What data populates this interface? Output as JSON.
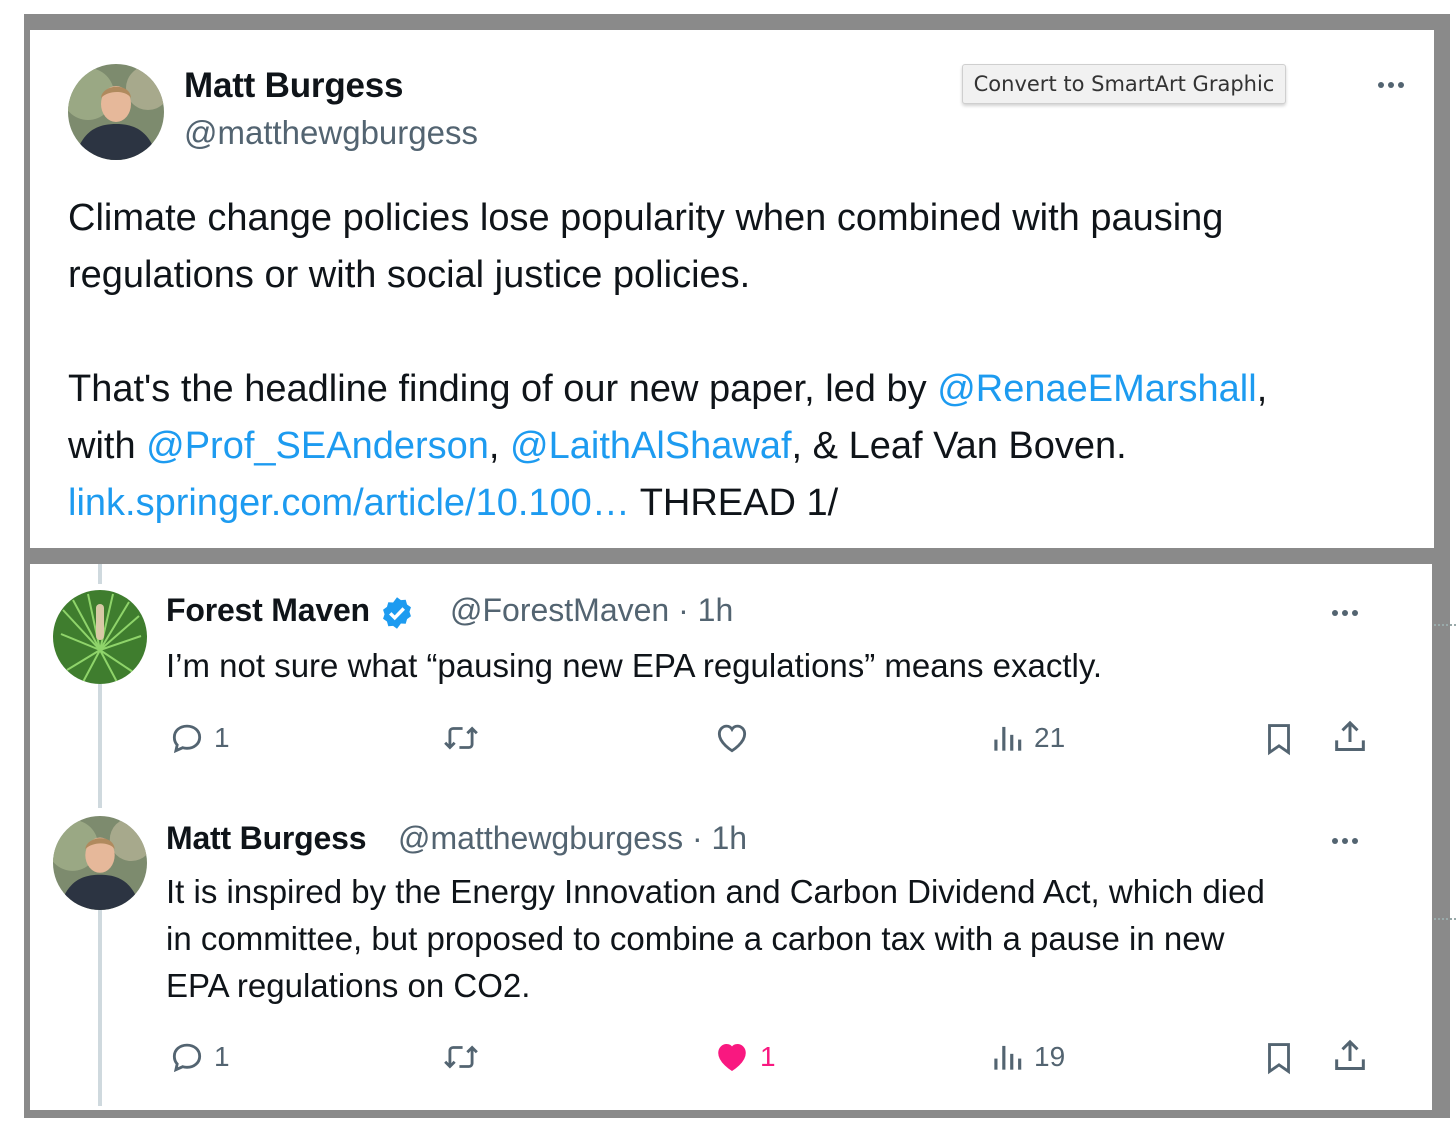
{
  "tweet": {
    "author_name": "Matt Burgess",
    "author_handle": "@matthewgburgess",
    "line1": "Climate change policies lose popularity when combined with pausing",
    "line2": "regulations or with social justice policies.",
    "line3_pre": "That's the headline finding of our new paper, led by ",
    "mention1": "@RenaeEMarshall",
    "line3_post": ",",
    "line4_pre": "with ",
    "mention2": "@Prof_SEAnderson",
    "sep1": ", ",
    "mention3": "@LaithAlShawaf",
    "line4_post": ", & Leaf Van Boven.",
    "link": "link.springer.com/article/10.100…",
    "link_post": " THREAD 1/"
  },
  "tooltip": {
    "label": "Convert to SmartArt Graphic"
  },
  "replies": [
    {
      "name": "Forest Maven",
      "handle": "@ForestMaven",
      "time": "· 1h",
      "verified": true,
      "text_lines": [
        "I’m not sure what “pausing new EPA regulations” means exactly."
      ],
      "reply_count": "1",
      "retweet_count": "",
      "like_count": "",
      "liked": false,
      "views": "21",
      "icons": [
        "reply-icon",
        "retweet-icon",
        "like-icon",
        "views-icon",
        "bookmark-icon",
        "share-icon"
      ]
    },
    {
      "name": "Matt Burgess",
      "handle": "@matthewgburgess",
      "time": "· 1h",
      "verified": false,
      "text_lines": [
        "It is inspired by the Energy Innovation and Carbon Dividend Act, which died",
        "in committee, but proposed to combine a carbon tax with a pause in new",
        "EPA regulations on CO2."
      ],
      "reply_count": "1",
      "retweet_count": "",
      "like_count": "1",
      "liked": true,
      "views": "19",
      "icons": [
        "reply-icon",
        "retweet-icon",
        "like-icon",
        "views-icon",
        "bookmark-icon",
        "share-icon"
      ]
    }
  ],
  "colors": {
    "link": "#1d9bf0",
    "muted": "#536471",
    "like": "#f91880",
    "verified": "#1d9bf0"
  }
}
